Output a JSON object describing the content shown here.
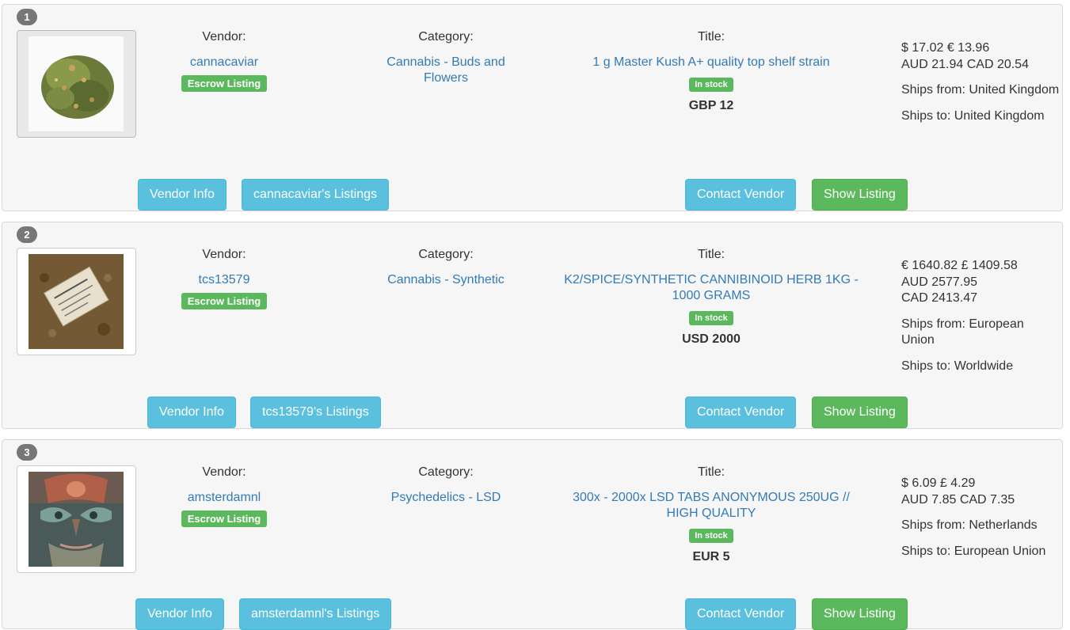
{
  "listings": [
    {
      "rank": "1",
      "vendor_label": "Vendor:",
      "vendor": "cannacaviar",
      "escrow": "Escrow Listing",
      "category_label": "Category:",
      "category": "Cannabis - Buds and Flowers",
      "title_label": "Title:",
      "title": "1 g Master Kush A+ quality top shelf strain",
      "stock": "In stock",
      "price": "GBP 12",
      "prices_line1": "$ 17.02 € 13.96",
      "prices_line2": "AUD 21.94 CAD 20.54",
      "ships_from": "Ships from: United Kingdom",
      "ships_to": "Ships to: United Kingdom",
      "btn_vendor_info": "Vendor Info",
      "btn_listings": "cannacaviar's Listings",
      "btn_contact": "Contact Vendor",
      "btn_show": "Show Listing",
      "image_icon": "cannabis-bud-image"
    },
    {
      "rank": "2",
      "vendor_label": "Vendor:",
      "vendor": "tcs13579",
      "escrow": "Escrow Listing",
      "category_label": "Category:",
      "category": "Cannabis - Synthetic",
      "title_label": "Title:",
      "title": "K2/SPICE/SYNTHETIC CANNIBINOID HERB 1KG - 1000 GRAMS",
      "stock": "In stock",
      "price": "USD 2000",
      "prices_line1": "€ 1640.82 £ 1409.58",
      "prices_line2": "AUD 2577.95",
      "prices_line3": "CAD 2413.47",
      "ships_from": "Ships from: European Union",
      "ships_to": "Ships to: Worldwide",
      "btn_vendor_info": "Vendor Info",
      "btn_listings": "tcs13579's Listings",
      "btn_contact": "Contact Vendor",
      "btn_show": "Show Listing",
      "image_icon": "herb-bag-image"
    },
    {
      "rank": "3",
      "vendor_label": "Vendor:",
      "vendor": "amsterdamnl",
      "escrow": "Escrow Listing",
      "category_label": "Category:",
      "category": "Psychedelics - LSD",
      "title_label": "Title:",
      "title": "300x - 2000x LSD TABS ANONYMOUS 250UG // HIGH QUALITY",
      "stock": "In stock",
      "price": "EUR 5",
      "prices_line1": "$ 6.09 £ 4.29",
      "prices_line2": "AUD 7.85 CAD 7.35",
      "ships_from": "Ships from: Netherlands",
      "ships_to": "Ships to: European Union",
      "btn_vendor_info": "Vendor Info",
      "btn_listings": "amsterdamnl's Listings",
      "btn_contact": "Contact Vendor",
      "btn_show": "Show Listing",
      "image_icon": "psychedelic-art-image"
    }
  ],
  "colors": {
    "link": "#337ab7",
    "success": "#5cb85c",
    "info": "#5bc0de",
    "badge": "#777777"
  }
}
